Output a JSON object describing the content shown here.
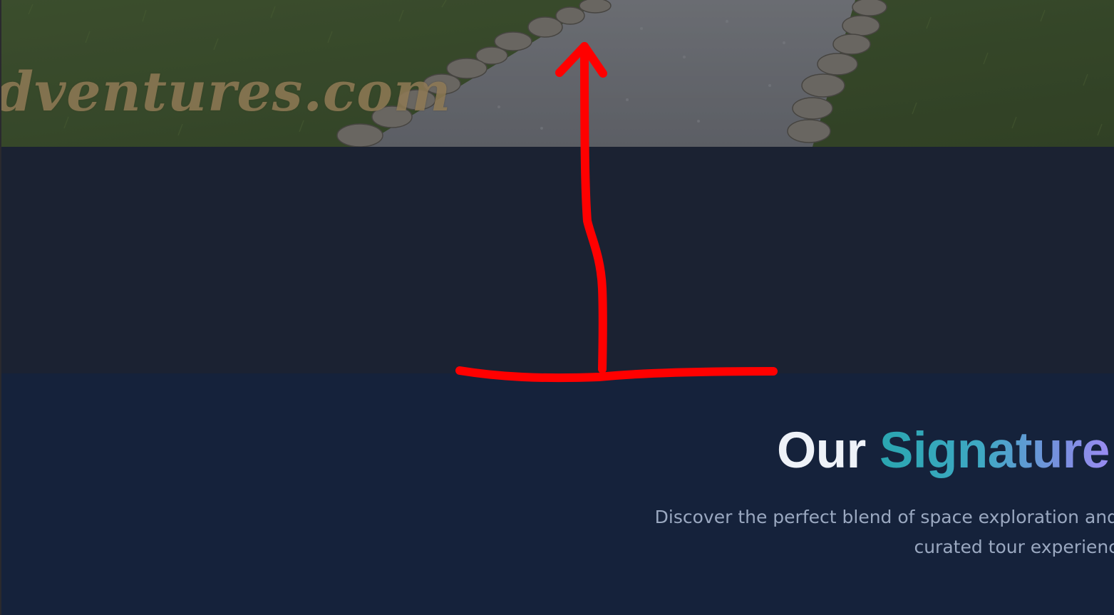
{
  "hero": {
    "watermark_text": "dventures.com"
  },
  "signature_section": {
    "heading_part1": "Our",
    "heading_part2": "Signature",
    "subtitle_line1": "Discover the perfect blend of space exploration and",
    "subtitle_line2": "curated tour experienc"
  },
  "colors": {
    "dark_band": "#1b2232",
    "section_bg": "#15223b",
    "heading_white": "#eef2f8",
    "heading_gradient_start": "#2aa6b0",
    "heading_gradient_end": "#9a8cf2",
    "subtitle": "#9aa8c0",
    "annotation_red": "#ff0000"
  },
  "annotation": {
    "shape": "upward-arrow-on-horizontal-line"
  }
}
